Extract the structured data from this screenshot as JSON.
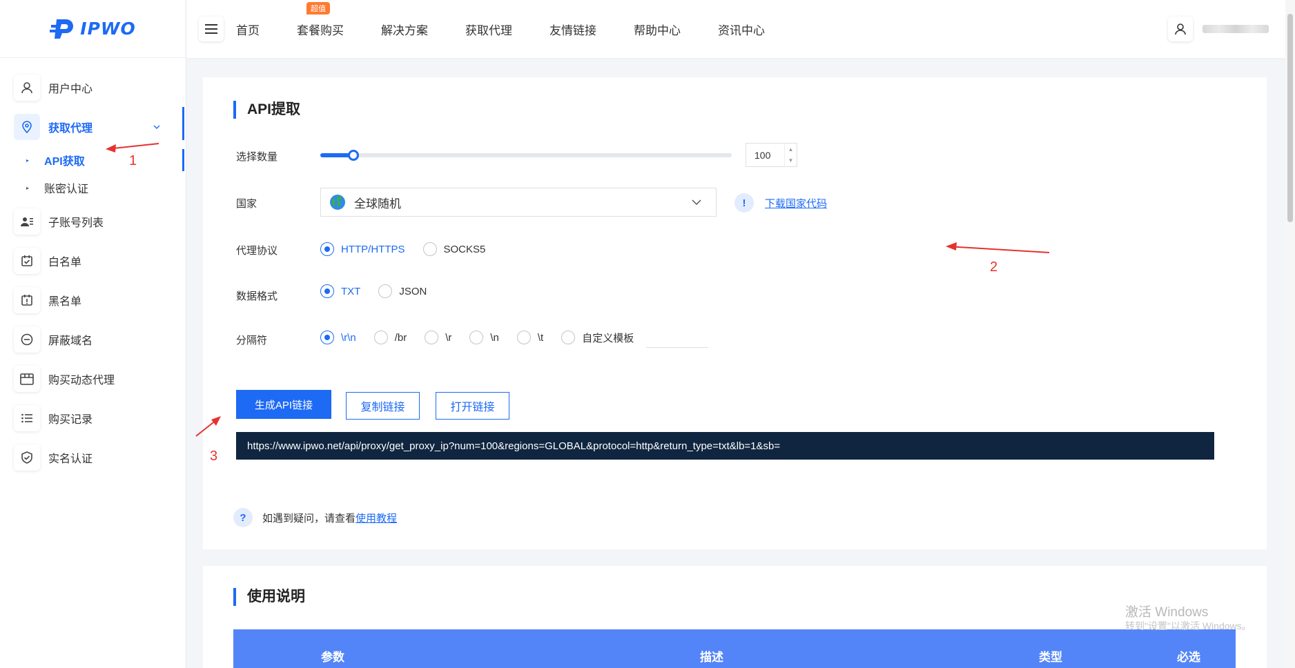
{
  "brand": {
    "logo_text": "IPWO",
    "primary_color": "#1d6af5"
  },
  "header": {
    "nav": [
      {
        "label": "首页"
      },
      {
        "label": "套餐购买",
        "badge": "超值"
      },
      {
        "label": "解决方案"
      },
      {
        "label": "获取代理"
      },
      {
        "label": "友情链接"
      },
      {
        "label": "帮助中心"
      },
      {
        "label": "资讯中心"
      }
    ]
  },
  "sidebar": {
    "items": [
      {
        "label": "用户中心",
        "icon": "user-icon"
      },
      {
        "label": "获取代理",
        "icon": "location-pin-icon",
        "active": true
      },
      {
        "label": "子账号列表",
        "icon": "contacts-icon"
      },
      {
        "label": "白名单",
        "icon": "calendar-check-icon"
      },
      {
        "label": "黑名单",
        "icon": "calendar-alert-icon"
      },
      {
        "label": "屏蔽域名",
        "icon": "minus-circle-icon"
      },
      {
        "label": "购买动态代理",
        "icon": "shop-icon"
      },
      {
        "label": "购买记录",
        "icon": "list-icon"
      },
      {
        "label": "实名认证",
        "icon": "shield-check-icon"
      }
    ],
    "sub_items": [
      {
        "label": "API获取",
        "active": true
      },
      {
        "label": "账密认证"
      }
    ]
  },
  "api": {
    "title": "API提取",
    "quantity": {
      "label": "选择数量",
      "value": "100",
      "level_fraction": 0.08
    },
    "country": {
      "label": "国家",
      "selected": "全球随机",
      "download_link": "下载国家代码",
      "info_mark": "!"
    },
    "protocol": {
      "label": "代理协议",
      "options": [
        "HTTP/HTTPS",
        "SOCKS5"
      ],
      "selected": "HTTP/HTTPS"
    },
    "format": {
      "label": "数据格式",
      "options": [
        "TXT",
        "JSON"
      ],
      "selected": "TXT"
    },
    "separator": {
      "label": "分隔符",
      "options": [
        "\\r\\n",
        "/br",
        "\\r",
        "\\n",
        "\\t",
        "自定义模板"
      ],
      "selected": "\\r\\n"
    },
    "buttons": {
      "generate": "生成API链接",
      "copy": "复制链接",
      "open": "打开链接"
    },
    "url": "https://www.ipwo.net/api/proxy/get_proxy_ip?num=100&regions=GLOBAL&protocol=http&return_type=txt&lb=1&sb=",
    "help": {
      "mark": "?",
      "text": "如遇到疑问，请查看",
      "link": "使用教程"
    }
  },
  "usage": {
    "title": "使用说明",
    "columns": [
      "参数",
      "描述",
      "类型",
      "必选"
    ]
  },
  "annotations": [
    "1",
    "2",
    "3"
  ],
  "watermark": {
    "line1": "激活 Windows",
    "line2": "转到\"设置\"以激活 Windows。"
  }
}
